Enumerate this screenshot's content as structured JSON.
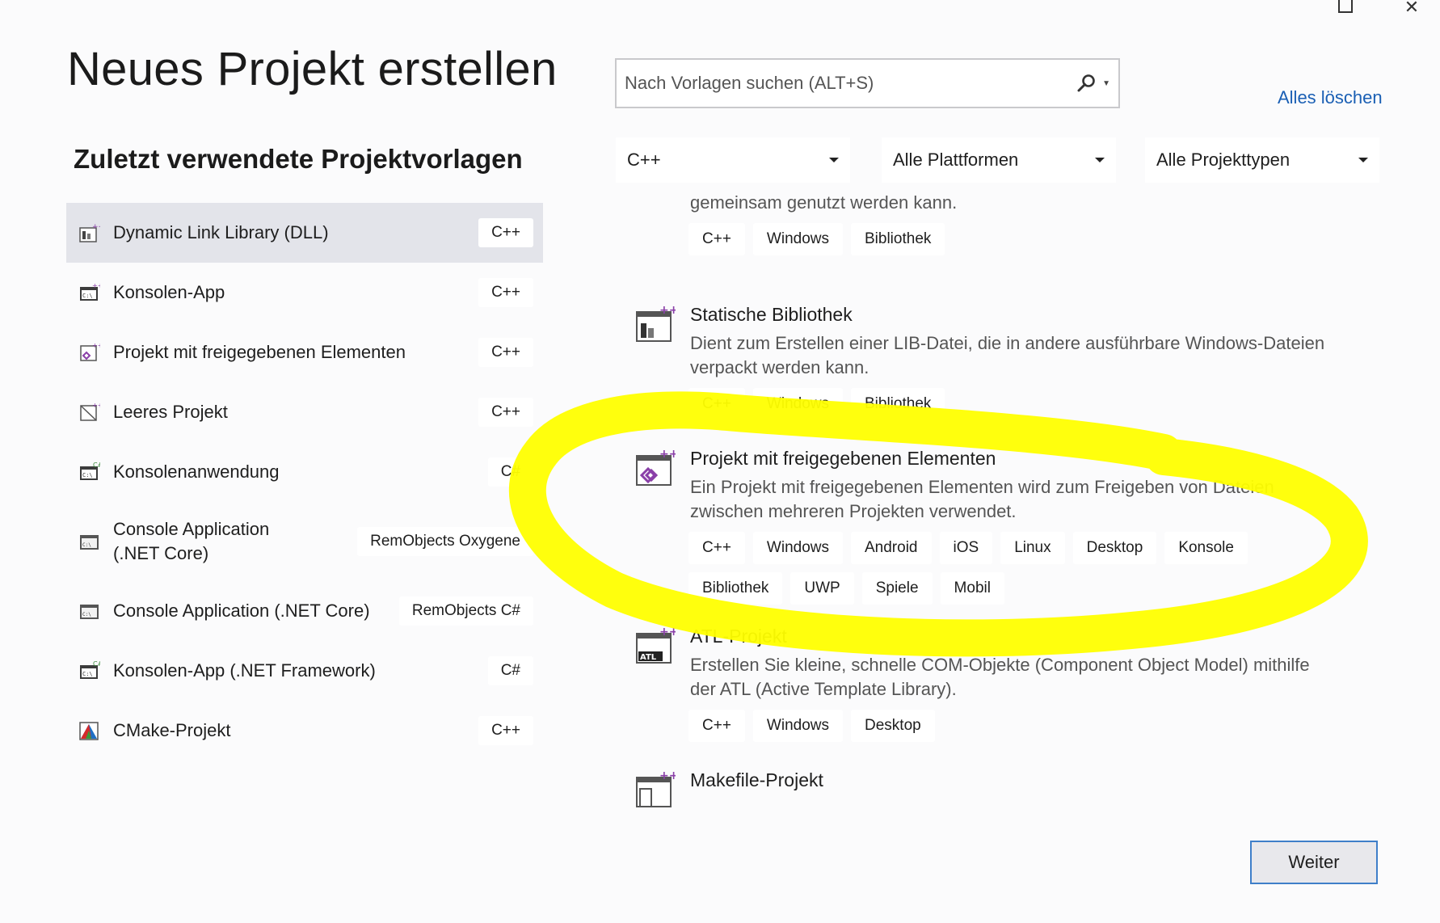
{
  "window": {
    "maximize_icon": "maximize-icon",
    "close_icon": "close-icon",
    "close_glyph": "✕"
  },
  "header": {
    "title": "Neues Projekt erstellen",
    "recent_title": "Zuletzt verwendete Projektvorlagen"
  },
  "search": {
    "placeholder": "Nach Vorlagen suchen (ALT+S)",
    "icon": "search-icon"
  },
  "clear_all_label": "Alles löschen",
  "filters": {
    "language": "C++",
    "platform": "Alle Plattformen",
    "project_type": "Alle Projekttypen"
  },
  "recent": [
    {
      "label": "Dynamic Link Library (DLL)",
      "tag": "C++",
      "icon": "dll-project-icon"
    },
    {
      "label": "Konsolen-App",
      "tag": "C++",
      "icon": "console-app-icon"
    },
    {
      "label": "Projekt mit freigegebenen Elementen",
      "tag": "C++",
      "icon": "shared-items-project-icon"
    },
    {
      "label": "Leeres Projekt",
      "tag": "C++",
      "icon": "empty-project-icon"
    },
    {
      "label": "Konsolenanwendung",
      "tag": "C#",
      "icon": "csharp-console-icon"
    },
    {
      "label": "Console Application (.NET Core)",
      "tag": "RemObjects Oxygene",
      "icon": "console-application-icon"
    },
    {
      "label": "Console Application (.NET Core)",
      "tag": "RemObjects C#",
      "icon": "console-application-icon"
    },
    {
      "label": "Konsolen-App (.NET Framework)",
      "tag": "C#",
      "icon": "csharp-console-icon"
    },
    {
      "label": "CMake-Projekt",
      "tag": "C++",
      "icon": "cmake-icon"
    }
  ],
  "templates": [
    {
      "name": "",
      "description": "gemeinsam genutzt werden kann.",
      "tags": [
        "C++",
        "Windows",
        "Bibliothek"
      ]
    },
    {
      "name": "Statische Bibliothek",
      "description": "Dient zum Erstellen einer LIB-Datei, die in andere ausführbare Windows-Dateien verpackt werden kann.",
      "tags": [
        "C++",
        "Windows",
        "Bibliothek"
      ],
      "icon": "static-library-icon"
    },
    {
      "name": "Projekt mit freigegebenen Elementen",
      "description": "Ein Projekt mit freigegebenen Elementen wird zum Freigeben von Dateien zwischen mehreren Projekten verwendet.",
      "tags": [
        "C++",
        "Windows",
        "Android",
        "iOS",
        "Linux",
        "Desktop",
        "Konsole",
        "Bibliothek",
        "UWP",
        "Spiele",
        "Mobil"
      ],
      "icon": "shared-items-project-icon"
    },
    {
      "name": "ATL-Projekt",
      "description": "Erstellen Sie kleine, schnelle COM-Objekte (Component Object Model) mithilfe der ATL (Active Template Library).",
      "tags": [
        "C++",
        "Windows",
        "Desktop"
      ],
      "icon": "atl-project-icon",
      "icon_text": "ATL"
    },
    {
      "name": "Makefile-Projekt",
      "description": "",
      "tags": [],
      "icon": "makefile-project-icon"
    }
  ],
  "next_button": "Weiter",
  "colors": {
    "accent": "#1a5fb4",
    "highlight": "#ffff00",
    "selected_bg": "#e3e4ea"
  }
}
